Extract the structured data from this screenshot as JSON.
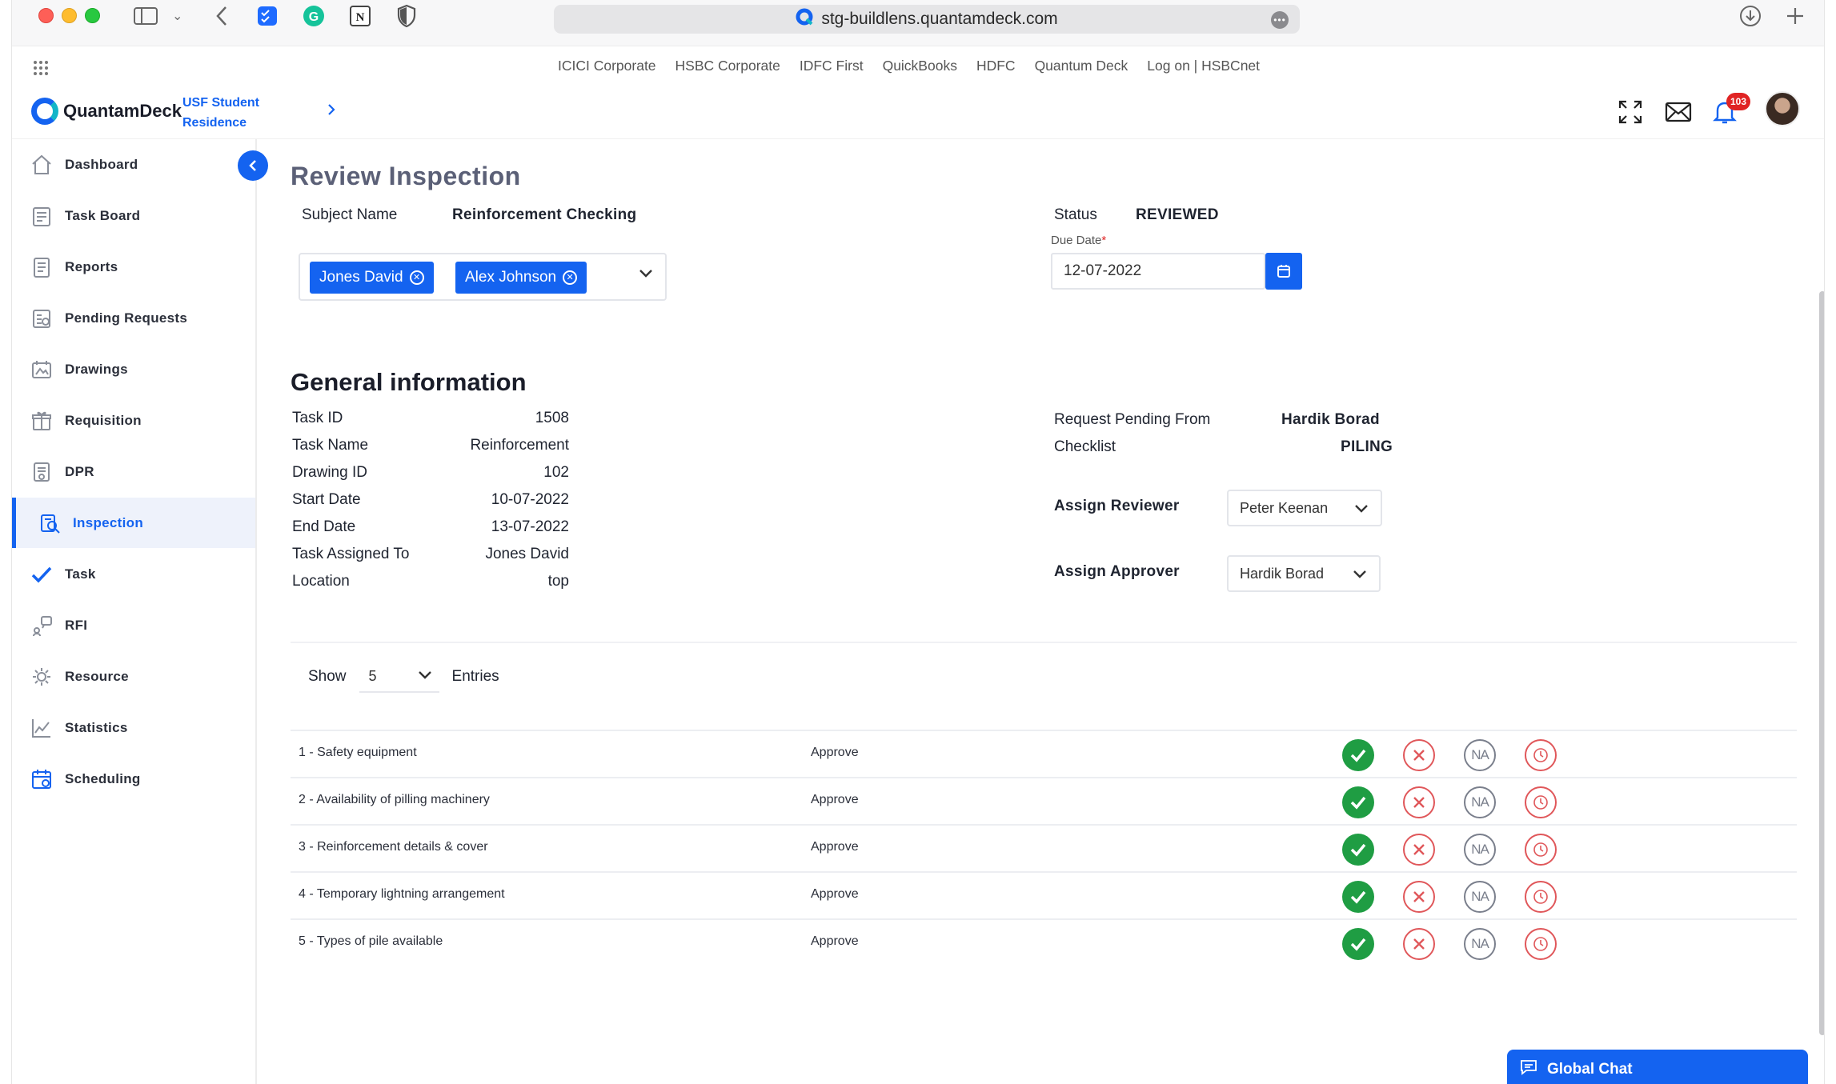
{
  "browser": {
    "url": "stg-buildlens.quantamdeck.com",
    "bookmarks": [
      "ICICI Corporate",
      "HSBC Corporate",
      "IDFC First",
      "QuickBooks",
      "HDFC",
      "Quantum Deck",
      "Log on | HSBCnet"
    ]
  },
  "header": {
    "brand": "QuantamDeck",
    "project_line1": "USF Student",
    "project_line2": "Residence",
    "notification_count": "103"
  },
  "sidebar": {
    "items": [
      {
        "label": "Dashboard",
        "icon": "home-icon"
      },
      {
        "label": "Task Board",
        "icon": "taskboard-icon"
      },
      {
        "label": "Reports",
        "icon": "reports-icon"
      },
      {
        "label": "Pending Requests",
        "icon": "pending-icon"
      },
      {
        "label": "Drawings",
        "icon": "drawings-icon"
      },
      {
        "label": "Requisition",
        "icon": "requisition-icon"
      },
      {
        "label": "DPR",
        "icon": "dpr-icon"
      },
      {
        "label": "Inspection",
        "icon": "inspection-icon",
        "active": true
      },
      {
        "label": "Task",
        "icon": "check-icon"
      },
      {
        "label": "RFI",
        "icon": "rfi-icon"
      },
      {
        "label": "Resource",
        "icon": "resource-icon"
      },
      {
        "label": "Statistics",
        "icon": "statistics-icon"
      },
      {
        "label": "Scheduling",
        "icon": "calendar-icon"
      }
    ]
  },
  "review": {
    "title": "Review Inspection",
    "subject_label": "Subject Name",
    "subject_value": "Reinforcement Checking",
    "status_label": "Status",
    "status_value": "REVIEWED",
    "due_label": "Due Date",
    "due_required": "*",
    "due_value": "12-07-2022",
    "tags": [
      "Jones David",
      "Alex Johnson"
    ]
  },
  "general": {
    "title": "General information",
    "rows": [
      {
        "label": "Task ID",
        "value": "1508"
      },
      {
        "label": "Task Name",
        "value": "Reinforcement"
      },
      {
        "label": "Drawing ID",
        "value": "102"
      },
      {
        "label": "Start Date",
        "value": "10-07-2022"
      },
      {
        "label": "End Date",
        "value": "13-07-2022"
      },
      {
        "label": "Task Assigned To",
        "value": "Jones David"
      },
      {
        "label": "Location",
        "value": "top"
      }
    ],
    "pending_label": "Request Pending From",
    "pending_value": "Hardik Borad",
    "checklist_label": "Checklist",
    "checklist_value": "PILING",
    "reviewer_label": "Assign Reviewer",
    "reviewer_value": "Peter Keenan",
    "approver_label": "Assign Approver",
    "approver_value": "Hardik Borad"
  },
  "table": {
    "show_label": "Show",
    "entries_value": "5",
    "entries_label": "Entries",
    "na_text": "NA",
    "rows": [
      {
        "item": "1 - Safety equipment",
        "action": "Approve"
      },
      {
        "item": "2 - Availability of pilling machinery",
        "action": "Approve"
      },
      {
        "item": "3 - Reinforcement details & cover",
        "action": "Approve"
      },
      {
        "item": "4 - Temporary lightning arrangement",
        "action": "Approve"
      },
      {
        "item": "5 - Types of pile available",
        "action": "Approve"
      }
    ]
  },
  "chat": {
    "label": "Global Chat"
  },
  "colors": {
    "accent": "#1463f0",
    "success": "#1f9d43",
    "danger": "#e0575a",
    "muted": "#7a7f8c"
  }
}
